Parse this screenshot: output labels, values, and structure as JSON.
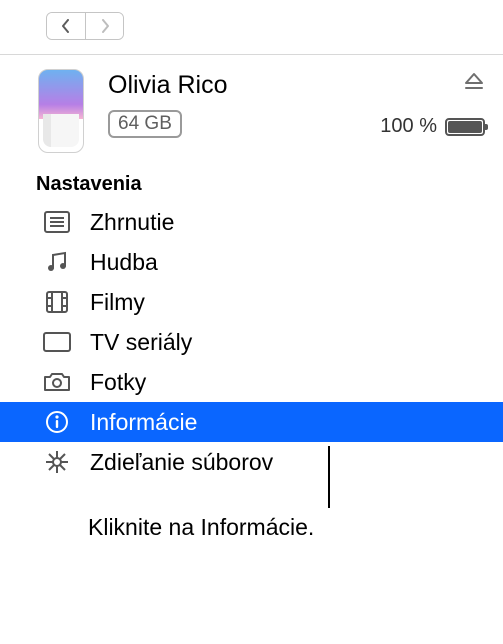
{
  "device": {
    "name": "Olivia Rico",
    "storage": "64 GB",
    "battery_pct": "100 %"
  },
  "section_title": "Nastavenia",
  "items": [
    {
      "label": "Zhrnutie"
    },
    {
      "label": "Hudba"
    },
    {
      "label": "Filmy"
    },
    {
      "label": "TV seriály"
    },
    {
      "label": "Fotky"
    },
    {
      "label": "Informácie"
    },
    {
      "label": "Zdieľanie súborov"
    }
  ],
  "callout": "Kliknite na Informácie."
}
